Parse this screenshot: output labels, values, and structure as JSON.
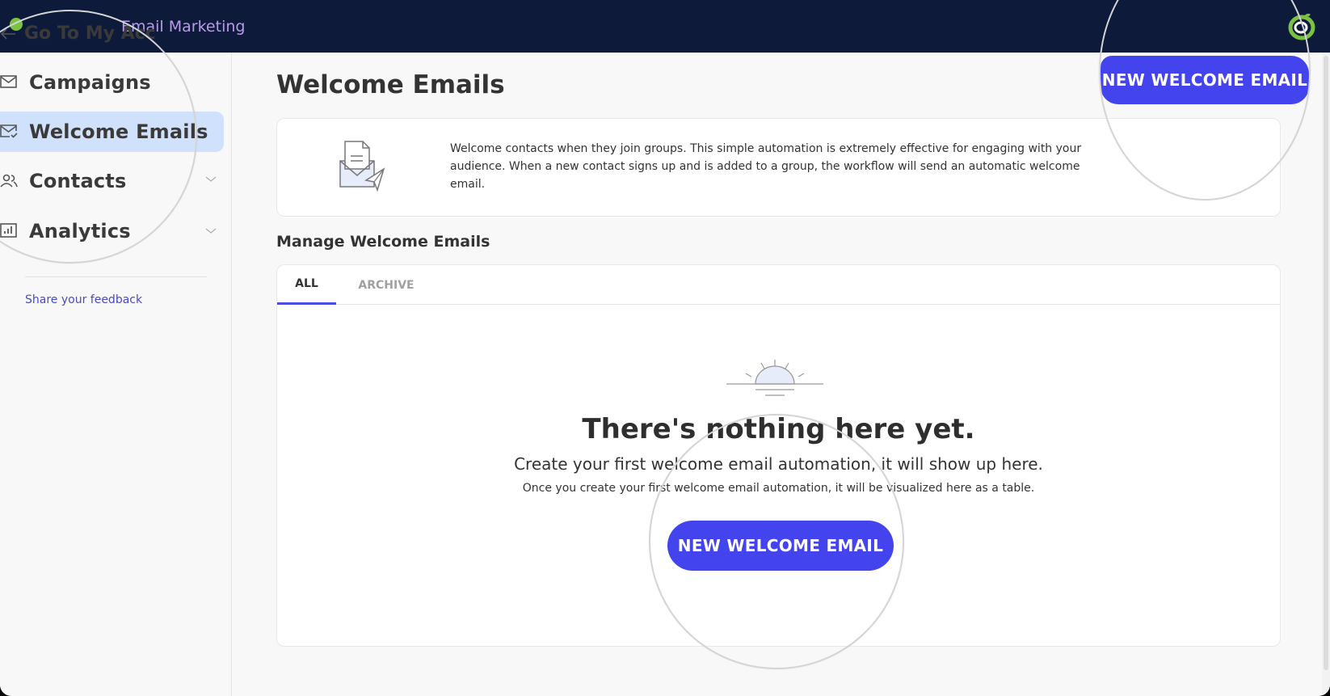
{
  "topbar": {
    "app_title": "Email Marketing",
    "logo_icon": "brand-swirl-logo",
    "colors": {
      "background": "#0e1a3a",
      "title": "#b89be8",
      "logo": "#7cc242"
    }
  },
  "sidebar": {
    "back_label": "Go To My Account",
    "back_visible": "Go To My Acc",
    "items": [
      {
        "label": "Campaigns",
        "icon": "envelope-icon",
        "active": false,
        "has_chevron": false
      },
      {
        "label": "Welcome Emails",
        "icon": "envelope-check-icon",
        "active": true,
        "has_chevron": false
      },
      {
        "label": "Contacts",
        "icon": "users-icon",
        "active": false,
        "has_chevron": true
      },
      {
        "label": "Analytics",
        "icon": "bar-chart-icon",
        "active": false,
        "has_chevron": true
      }
    ],
    "feedback_link": "Share your feedback",
    "colors": {
      "active_bg": "#cfe1fb",
      "link": "#4a4ac8"
    }
  },
  "main": {
    "page_title": "Welcome Emails",
    "new_button_label": "NEW WELCOME EMAIL",
    "info": {
      "description": "Welcome contacts when they join groups. This simple automation is extremely effective for engaging with your audience. When a new contact signs up and is added to a group, the workflow will send an automatic welcome email.",
      "icon": "envelope-paper-plane-icon"
    },
    "section_title": "Manage Welcome Emails",
    "tabs": [
      {
        "label": "ALL",
        "active": true
      },
      {
        "label": "ARCHIVE",
        "active": false
      }
    ],
    "empty_state": {
      "icon": "sunrise-icon",
      "title": "There's nothing here yet.",
      "subtitle": "Create your first welcome email automation, it will show up here.",
      "description": "Once you create your first welcome email automation, it will be visualized here as a table.",
      "button_label": "NEW WELCOME EMAIL"
    },
    "colors": {
      "primary": "#4444ee",
      "tab_indicator": "#4c4ce0"
    }
  }
}
